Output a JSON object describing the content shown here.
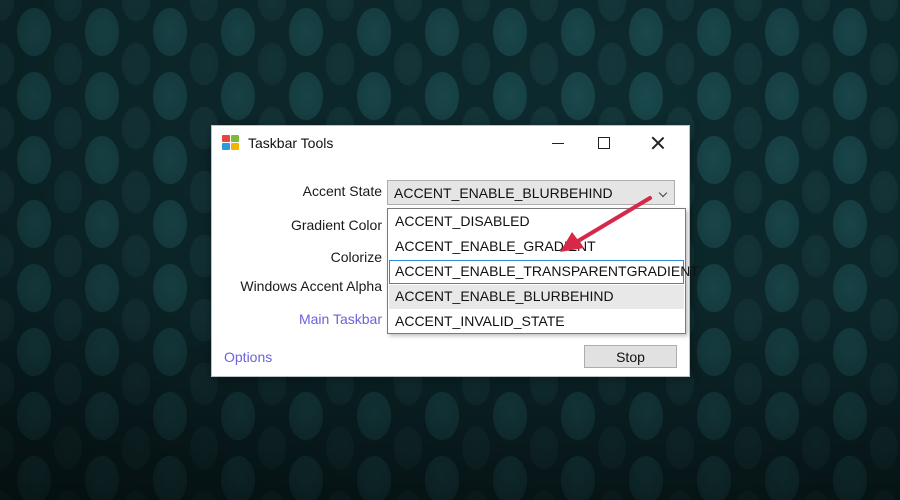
{
  "window": {
    "title": "Taskbar Tools",
    "icon": "taskbar-tools-app-icon",
    "controls": {
      "minimize": "minimize-icon",
      "maximize": "maximize-icon",
      "close": "close-icon"
    }
  },
  "labels": {
    "accent_state": "Accent State",
    "gradient_color": "Gradient Color",
    "colorize": "Colorize",
    "windows_accent_alpha": "Windows Accent Alpha",
    "main_taskbar": "Main Taskbar"
  },
  "accent_state_select": {
    "value": "ACCENT_ENABLE_BLURBEHIND",
    "expanded": true,
    "options": [
      "ACCENT_DISABLED",
      "ACCENT_ENABLE_GRADIENT",
      "ACCENT_ENABLE_TRANSPARENTGRADIENT",
      "ACCENT_ENABLE_BLURBEHIND",
      "ACCENT_INVALID_STATE"
    ],
    "focused_option": "ACCENT_ENABLE_TRANSPARENTGRADIENT",
    "selected_option": "ACCENT_ENABLE_BLURBEHIND"
  },
  "footer": {
    "options_link": "Options",
    "stop_button": "Stop"
  },
  "colors": {
    "link": "#6b63d8",
    "focus_border": "#2f8ad8",
    "annotation_arrow": "#d6294a",
    "desktop": "#0d2a2e"
  }
}
